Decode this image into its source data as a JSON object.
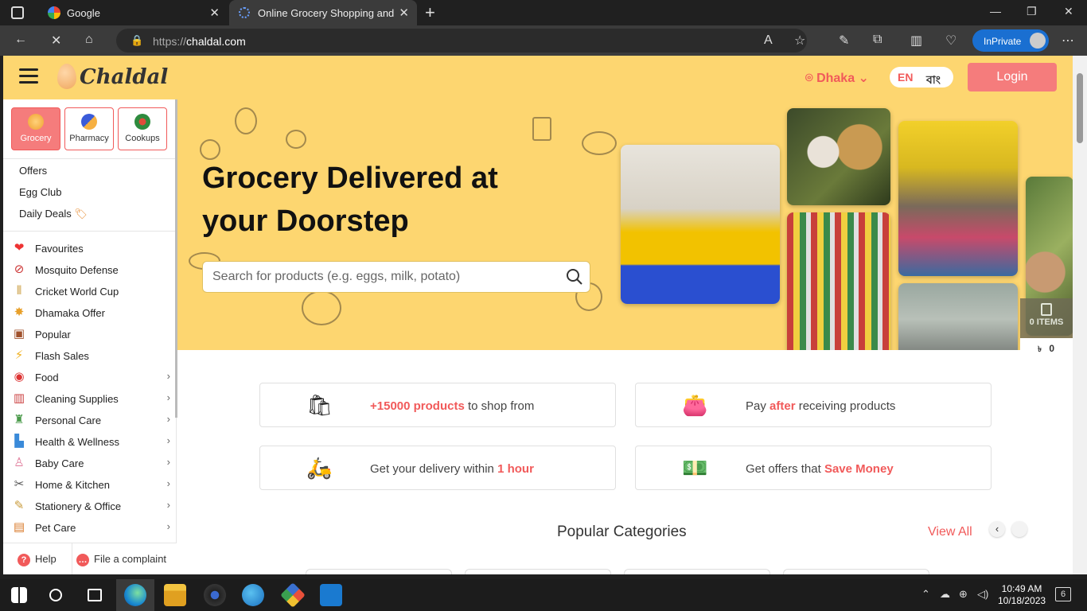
{
  "browser": {
    "tabs": [
      {
        "title": "Google"
      },
      {
        "title": "Online Grocery Shopping and De"
      }
    ],
    "url_prefix": "https://",
    "url_host": "chaldal.com",
    "inprivate_label": "InPrivate"
  },
  "header": {
    "logo_text": "Chaldal",
    "location": "Dhaka",
    "lang_en": "EN",
    "lang_bn": "বাং",
    "login_label": "Login"
  },
  "sidebar": {
    "category_tabs": [
      {
        "label": "Grocery",
        "active": true
      },
      {
        "label": "Pharmacy",
        "active": false
      },
      {
        "label": "Cookups",
        "active": false
      }
    ],
    "links": [
      "Offers",
      "Egg Club",
      "Daily Deals"
    ],
    "items": [
      {
        "label": "Favourites",
        "icon": "heart-icon"
      },
      {
        "label": "Mosquito Defense",
        "icon": "mosquito-icon"
      },
      {
        "label": "Cricket World Cup",
        "icon": "cricket-icon"
      },
      {
        "label": "Dhamaka Offer",
        "icon": "burst-icon"
      },
      {
        "label": "Popular",
        "icon": "basket-icon"
      },
      {
        "label": "Flash Sales",
        "icon": "lightning-icon"
      },
      {
        "label": "Food",
        "icon": "food-icon"
      },
      {
        "label": "Cleaning Supplies",
        "icon": "cleaning-icon"
      },
      {
        "label": "Personal Care",
        "icon": "personal-care-icon"
      },
      {
        "label": "Health & Wellness",
        "icon": "health-icon"
      },
      {
        "label": "Baby Care",
        "icon": "baby-icon"
      },
      {
        "label": "Home & Kitchen",
        "icon": "kitchen-icon"
      },
      {
        "label": "Stationery & Office",
        "icon": "stationery-icon"
      },
      {
        "label": "Pet Care",
        "icon": "pet-icon"
      }
    ],
    "footer": {
      "help": "Help",
      "complaint": "File a complaint"
    }
  },
  "hero": {
    "title": "Grocery Delivered at your Doorstep",
    "search_placeholder": "Search for products (e.g. eggs, milk, potato)"
  },
  "cart": {
    "items_label": "0 ITEMS",
    "currency": "৳",
    "total": "0"
  },
  "features": [
    {
      "hl_pre": "+15000 products",
      "text": " to shop from"
    },
    {
      "pre": "Pay ",
      "hl": "after",
      "post": " receiving products"
    },
    {
      "pre": "Get your delivery within ",
      "hl": "1 hour"
    },
    {
      "pre": "Get offers that ",
      "hl": "Save Money"
    }
  ],
  "popular": {
    "title": "Popular Categories",
    "view_all": "View All"
  },
  "taskbar": {
    "time": "10:49 AM",
    "date": "10/18/2023",
    "notifications": "6"
  },
  "colors": {
    "brand_yellow": "#fdd670",
    "accent_red": "#f15a5a",
    "login_bg": "#f57c7c"
  }
}
